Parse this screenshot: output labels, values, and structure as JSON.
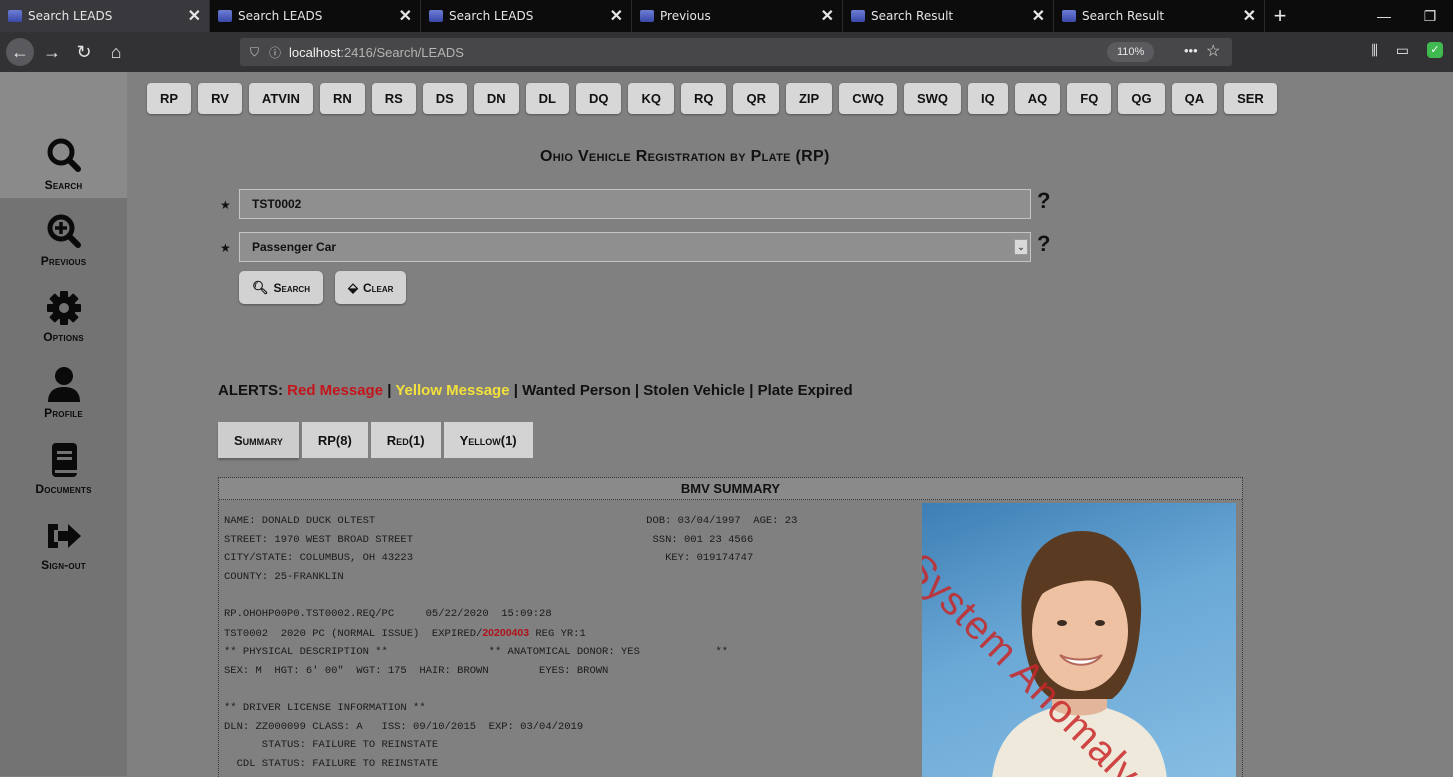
{
  "browser": {
    "tabs": [
      {
        "label": "Search LEADS",
        "active": true
      },
      {
        "label": "Search LEADS",
        "active": false
      },
      {
        "label": "Search LEADS",
        "active": false
      },
      {
        "label": "Previous",
        "active": false
      },
      {
        "label": "Search Result",
        "active": false
      },
      {
        "label": "Search Result",
        "active": false
      }
    ],
    "close_glyph": "✕",
    "new_tab_glyph": "+",
    "url_host": "localhost",
    "url_path": ":2416/Search/LEADS",
    "zoom": "110%",
    "more_glyph": "•••"
  },
  "sidebar": {
    "items": [
      {
        "label": "Search",
        "icon": "search-icon"
      },
      {
        "label": "Previous",
        "icon": "zoom-in-icon"
      },
      {
        "label": "Options",
        "icon": "gear-icon"
      },
      {
        "label": "Profile",
        "icon": "user-icon"
      },
      {
        "label": "Documents",
        "icon": "book-icon"
      },
      {
        "label": "Sign-out",
        "icon": "sign-out-icon"
      }
    ]
  },
  "queries": [
    "RP",
    "RV",
    "ATVIN",
    "RN",
    "RS",
    "DS",
    "DN",
    "DL",
    "DQ",
    "KQ",
    "RQ",
    "QR",
    "ZIP",
    "CWQ",
    "SWQ",
    "IQ",
    "AQ",
    "FQ",
    "QG",
    "QA",
    "SER"
  ],
  "form": {
    "title": "Ohio Vehicle Registration by Plate (RP)",
    "required_mark": "★",
    "plate_value": "TST0002",
    "plate_type_value": "Passenger Car",
    "help_glyph": "?",
    "search_label": "Search",
    "clear_label": "Clear"
  },
  "alerts": {
    "prefix": "ALERTS:",
    "red": "Red Message",
    "sep": "|",
    "yellow": "Yellow Message",
    "wanted": "Wanted Person",
    "stolen": "Stolen Vehicle",
    "expired": "Plate Expired"
  },
  "result_tabs": [
    "Summary",
    "RP(8)",
    "Red(1)",
    "Yellow(1)"
  ],
  "summary": {
    "header": "BMV SUMMARY",
    "line1": "NAME: DONALD DUCK OLTEST                                           DOB: 03/04/1997  AGE: 23",
    "line2": "STREET: 1970 WEST BROAD STREET                                      SSN: 001 23 4566",
    "line3": "CITY/STATE: COLUMBUS, OH 43223                                        KEY: 019174747",
    "line4": "COUNTY: 25-FRANKLIN",
    "line5": "",
    "line6": "RP.OHOHP00P0.TST0002.REQ/PC     05/22/2020  15:09:28",
    "line7a": "TST0002  2020 PC (NORMAL ISSUE)  EXPIRED/",
    "expired_date": "20200403",
    "line7b": " REG YR:1",
    "line8": "** PHYSICAL DESCRIPTION **                ** ANATOMICAL DONOR: YES            **",
    "line9": "SEX: M  HGT: 6' 00\"  WGT: 175  HAIR: BROWN        EYES: BROWN",
    "line10": "",
    "line11": "** DRIVER LICENSE INFORMATION **",
    "line12": "DLN: ZZ000099 CLASS: A   ISS: 09/10/2015  EXP: 03/04/2019",
    "line13": "      STATUS: FAILURE TO REINSTATE",
    "line14": "  CDL STATUS: FAILURE TO REINSTATE",
    "photo_watermark": "System Anomaly"
  }
}
